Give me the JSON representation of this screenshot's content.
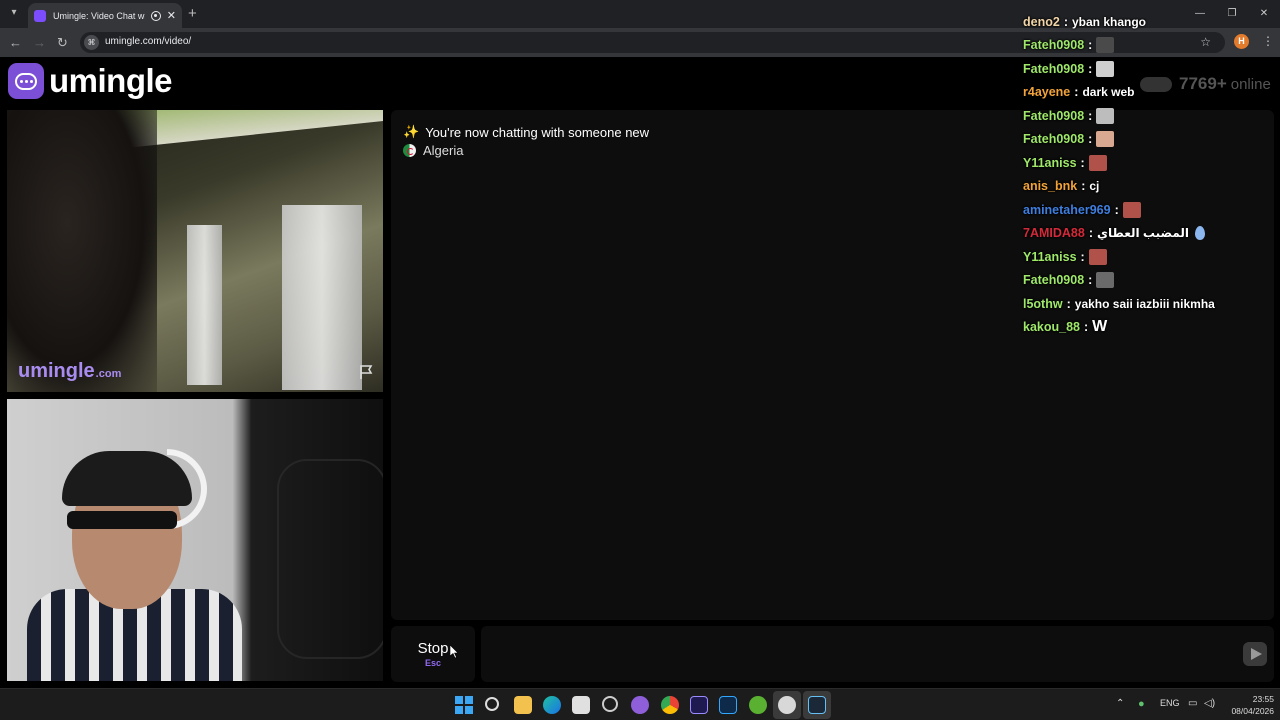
{
  "browser": {
    "tab_title": "Umingle: Video Chat with S",
    "url": "umingle.com/video/",
    "new_tab_symbol": "+",
    "profile_initial": "H",
    "colors": {
      "tabbar": "#202124",
      "toolbar": "#35363a"
    }
  },
  "site": {
    "logo_text": "umingle",
    "online_count": "7769+",
    "online_label": "online",
    "accent_color": "#7b4fd6"
  },
  "stranger_video": {
    "watermark_main": "umingle",
    "watermark_tld": ".com",
    "report_icon": "flag-icon"
  },
  "chat": {
    "system_message": "You're now chatting with someone new",
    "system_icon": "sparkles-icon",
    "country": "Algeria"
  },
  "controls": {
    "stop_label": "Stop",
    "stop_key": "Esc",
    "message_placeholder": "",
    "send_icon": "send-icon"
  },
  "overlay_chat": [
    {
      "user": "deno2",
      "color": "#f2d6a8",
      "text": "yban khango"
    },
    {
      "user": "Fateh0908",
      "color": "#9fe86a",
      "emote": "#4a4a4a"
    },
    {
      "user": "Fateh0908",
      "color": "#9fe86a",
      "emote": "#cfcfcf"
    },
    {
      "user": "r4ayene",
      "color": "#f2a33a",
      "text": "dark web"
    },
    {
      "user": "Fateh0908",
      "color": "#9fe86a",
      "emote": "#bdbdbd"
    },
    {
      "user": "Fateh0908",
      "color": "#9fe86a",
      "emote": "#d8a890"
    },
    {
      "user": "Y11aniss",
      "color": "#9fe86a",
      "emote": "#b0524a"
    },
    {
      "user": "anis_bnk",
      "color": "#f2a33a",
      "text": "cj"
    },
    {
      "user": "aminetaher969",
      "color": "#3f7fe0",
      "emote": "#b0524a"
    },
    {
      "user": "7AMIDA88",
      "color": "#d42a3a",
      "text": "المضبب العطاي",
      "emote": "#8bb6f0"
    },
    {
      "user": "Y11aniss",
      "color": "#9fe86a",
      "emote": "#b0524a"
    },
    {
      "user": "Fateh0908",
      "color": "#9fe86a",
      "emote": "#6a6a6a"
    },
    {
      "user": "l5othw",
      "color": "#9fe86a",
      "text": "yakho saii iazbiii nikmha"
    },
    {
      "user": "kakou_88",
      "color": "#9fe86a",
      "text": "W"
    }
  ],
  "taskbar": {
    "language": "ENG",
    "time": "23:55",
    "date": "08/04/2026",
    "apps": [
      "start-icon",
      "search-icon",
      "file-explorer-icon",
      "edge-icon",
      "store-icon",
      "chatgpt-icon",
      "chat-app-icon",
      "chrome-icon",
      "premiere-icon",
      "photoshop-icon",
      "utorrent-icon",
      "media-player-icon",
      "steam-icon"
    ]
  }
}
